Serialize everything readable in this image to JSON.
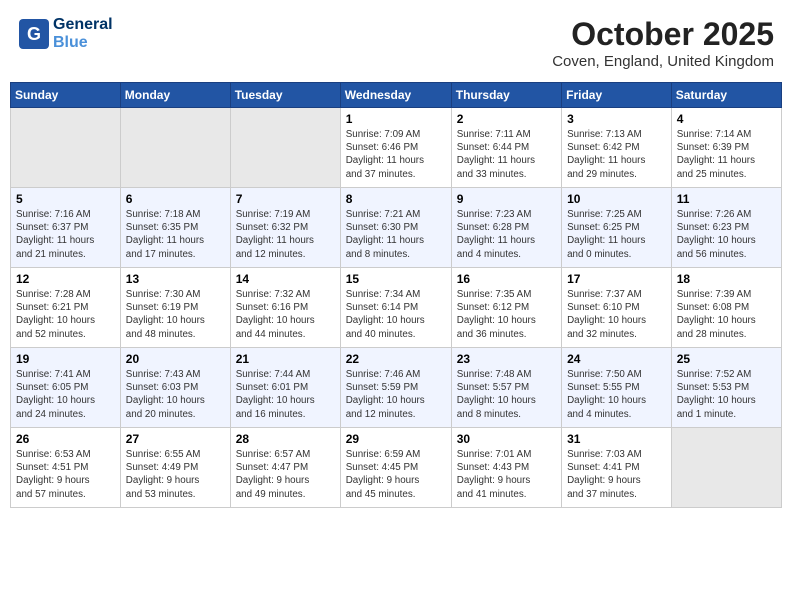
{
  "header": {
    "logo_line1": "General",
    "logo_line2": "Blue",
    "month": "October 2025",
    "location": "Coven, England, United Kingdom"
  },
  "weekdays": [
    "Sunday",
    "Monday",
    "Tuesday",
    "Wednesday",
    "Thursday",
    "Friday",
    "Saturday"
  ],
  "weeks": [
    [
      {
        "day": "",
        "info": ""
      },
      {
        "day": "",
        "info": ""
      },
      {
        "day": "",
        "info": ""
      },
      {
        "day": "1",
        "info": "Sunrise: 7:09 AM\nSunset: 6:46 PM\nDaylight: 11 hours\nand 37 minutes."
      },
      {
        "day": "2",
        "info": "Sunrise: 7:11 AM\nSunset: 6:44 PM\nDaylight: 11 hours\nand 33 minutes."
      },
      {
        "day": "3",
        "info": "Sunrise: 7:13 AM\nSunset: 6:42 PM\nDaylight: 11 hours\nand 29 minutes."
      },
      {
        "day": "4",
        "info": "Sunrise: 7:14 AM\nSunset: 6:39 PM\nDaylight: 11 hours\nand 25 minutes."
      }
    ],
    [
      {
        "day": "5",
        "info": "Sunrise: 7:16 AM\nSunset: 6:37 PM\nDaylight: 11 hours\nand 21 minutes."
      },
      {
        "day": "6",
        "info": "Sunrise: 7:18 AM\nSunset: 6:35 PM\nDaylight: 11 hours\nand 17 minutes."
      },
      {
        "day": "7",
        "info": "Sunrise: 7:19 AM\nSunset: 6:32 PM\nDaylight: 11 hours\nand 12 minutes."
      },
      {
        "day": "8",
        "info": "Sunrise: 7:21 AM\nSunset: 6:30 PM\nDaylight: 11 hours\nand 8 minutes."
      },
      {
        "day": "9",
        "info": "Sunrise: 7:23 AM\nSunset: 6:28 PM\nDaylight: 11 hours\nand 4 minutes."
      },
      {
        "day": "10",
        "info": "Sunrise: 7:25 AM\nSunset: 6:25 PM\nDaylight: 11 hours\nand 0 minutes."
      },
      {
        "day": "11",
        "info": "Sunrise: 7:26 AM\nSunset: 6:23 PM\nDaylight: 10 hours\nand 56 minutes."
      }
    ],
    [
      {
        "day": "12",
        "info": "Sunrise: 7:28 AM\nSunset: 6:21 PM\nDaylight: 10 hours\nand 52 minutes."
      },
      {
        "day": "13",
        "info": "Sunrise: 7:30 AM\nSunset: 6:19 PM\nDaylight: 10 hours\nand 48 minutes."
      },
      {
        "day": "14",
        "info": "Sunrise: 7:32 AM\nSunset: 6:16 PM\nDaylight: 10 hours\nand 44 minutes."
      },
      {
        "day": "15",
        "info": "Sunrise: 7:34 AM\nSunset: 6:14 PM\nDaylight: 10 hours\nand 40 minutes."
      },
      {
        "day": "16",
        "info": "Sunrise: 7:35 AM\nSunset: 6:12 PM\nDaylight: 10 hours\nand 36 minutes."
      },
      {
        "day": "17",
        "info": "Sunrise: 7:37 AM\nSunset: 6:10 PM\nDaylight: 10 hours\nand 32 minutes."
      },
      {
        "day": "18",
        "info": "Sunrise: 7:39 AM\nSunset: 6:08 PM\nDaylight: 10 hours\nand 28 minutes."
      }
    ],
    [
      {
        "day": "19",
        "info": "Sunrise: 7:41 AM\nSunset: 6:05 PM\nDaylight: 10 hours\nand 24 minutes."
      },
      {
        "day": "20",
        "info": "Sunrise: 7:43 AM\nSunset: 6:03 PM\nDaylight: 10 hours\nand 20 minutes."
      },
      {
        "day": "21",
        "info": "Sunrise: 7:44 AM\nSunset: 6:01 PM\nDaylight: 10 hours\nand 16 minutes."
      },
      {
        "day": "22",
        "info": "Sunrise: 7:46 AM\nSunset: 5:59 PM\nDaylight: 10 hours\nand 12 minutes."
      },
      {
        "day": "23",
        "info": "Sunrise: 7:48 AM\nSunset: 5:57 PM\nDaylight: 10 hours\nand 8 minutes."
      },
      {
        "day": "24",
        "info": "Sunrise: 7:50 AM\nSunset: 5:55 PM\nDaylight: 10 hours\nand 4 minutes."
      },
      {
        "day": "25",
        "info": "Sunrise: 7:52 AM\nSunset: 5:53 PM\nDaylight: 10 hours\nand 1 minute."
      }
    ],
    [
      {
        "day": "26",
        "info": "Sunrise: 6:53 AM\nSunset: 4:51 PM\nDaylight: 9 hours\nand 57 minutes."
      },
      {
        "day": "27",
        "info": "Sunrise: 6:55 AM\nSunset: 4:49 PM\nDaylight: 9 hours\nand 53 minutes."
      },
      {
        "day": "28",
        "info": "Sunrise: 6:57 AM\nSunset: 4:47 PM\nDaylight: 9 hours\nand 49 minutes."
      },
      {
        "day": "29",
        "info": "Sunrise: 6:59 AM\nSunset: 4:45 PM\nDaylight: 9 hours\nand 45 minutes."
      },
      {
        "day": "30",
        "info": "Sunrise: 7:01 AM\nSunset: 4:43 PM\nDaylight: 9 hours\nand 41 minutes."
      },
      {
        "day": "31",
        "info": "Sunrise: 7:03 AM\nSunset: 4:41 PM\nDaylight: 9 hours\nand 37 minutes."
      },
      {
        "day": "",
        "info": ""
      }
    ]
  ]
}
